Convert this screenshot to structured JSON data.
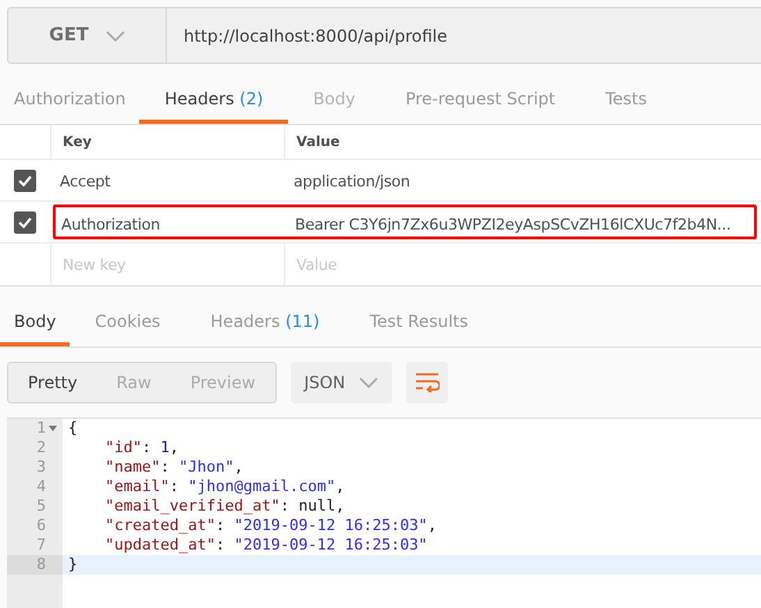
{
  "request": {
    "method": "GET",
    "url": "http://localhost:8000/api/profile"
  },
  "request_tabs": [
    {
      "label": "Authorization",
      "selected": false,
      "disabled": false
    },
    {
      "label": "Headers",
      "count": "(2)",
      "selected": true,
      "disabled": false
    },
    {
      "label": "Body",
      "selected": false,
      "disabled": true
    },
    {
      "label": "Pre-request Script",
      "selected": false,
      "disabled": false
    },
    {
      "label": "Tests",
      "selected": false,
      "disabled": false
    }
  ],
  "headers_table": {
    "columns": [
      "Key",
      "Value"
    ],
    "rows": [
      {
        "key": "Accept",
        "value": "application/json",
        "checked": true,
        "highlighted": false
      },
      {
        "key": "Authorization",
        "value": "Bearer C3Y6jn7Zx6u3WPZI2eyAspSCvZH16lCXUc7f2b4N...",
        "checked": true,
        "highlighted": true
      }
    ],
    "new_row": {
      "key_placeholder": "New key",
      "value_placeholder": "Value"
    }
  },
  "response_tabs": [
    {
      "label": "Body",
      "selected": true
    },
    {
      "label": "Cookies",
      "selected": false
    },
    {
      "label": "Headers",
      "count": "(11)",
      "selected": false
    },
    {
      "label": "Test Results",
      "selected": false
    }
  ],
  "view_modes": [
    {
      "label": "Pretty",
      "selected": true
    },
    {
      "label": "Raw",
      "selected": false
    },
    {
      "label": "Preview",
      "selected": false
    }
  ],
  "format": "JSON",
  "code": [
    {
      "number": "1",
      "fold": true,
      "current": false,
      "parts": [
        {
          "kind": "plain",
          "text": "{"
        }
      ]
    },
    {
      "number": "2",
      "fold": false,
      "current": false,
      "parts": [
        {
          "kind": "key",
          "text": "\"id\""
        },
        {
          "kind": "plain",
          "text": ": "
        },
        {
          "kind": "number",
          "text": "1"
        },
        {
          "kind": "plain",
          "text": ","
        }
      ]
    },
    {
      "number": "3",
      "fold": false,
      "current": false,
      "parts": [
        {
          "kind": "key",
          "text": "\"name\""
        },
        {
          "kind": "plain",
          "text": ": "
        },
        {
          "kind": "string",
          "text": "\"Jhon\""
        },
        {
          "kind": "plain",
          "text": ","
        }
      ]
    },
    {
      "number": "4",
      "fold": false,
      "current": false,
      "parts": [
        {
          "kind": "key",
          "text": "\"email\""
        },
        {
          "kind": "plain",
          "text": ": "
        },
        {
          "kind": "string",
          "text": "\"jhon@gmail.com\""
        },
        {
          "kind": "plain",
          "text": ","
        }
      ]
    },
    {
      "number": "5",
      "fold": false,
      "current": false,
      "parts": [
        {
          "kind": "key",
          "text": "\"email_verified_at\""
        },
        {
          "kind": "plain",
          "text": ": null,"
        }
      ]
    },
    {
      "number": "6",
      "fold": false,
      "current": false,
      "parts": [
        {
          "kind": "key",
          "text": "\"created_at\""
        },
        {
          "kind": "plain",
          "text": ": "
        },
        {
          "kind": "string",
          "text": "\"2019-09-12 16:25:03\""
        },
        {
          "kind": "plain",
          "text": ","
        }
      ]
    },
    {
      "number": "7",
      "fold": false,
      "current": false,
      "parts": [
        {
          "kind": "key",
          "text": "\"updated_at\""
        },
        {
          "kind": "plain",
          "text": ": "
        },
        {
          "kind": "string",
          "text": "\"2019-09-12 16:25:03\""
        }
      ]
    },
    {
      "number": "8",
      "fold": false,
      "current": true,
      "parts": [
        {
          "kind": "plain",
          "text": "}"
        }
      ]
    }
  ]
}
